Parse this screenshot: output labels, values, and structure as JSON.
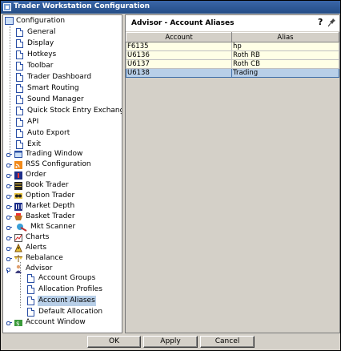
{
  "window": {
    "title": "Trader Workstation Configuration"
  },
  "tree": {
    "root": "Configuration",
    "items": [
      {
        "label": "General",
        "icon": "page-icon"
      },
      {
        "label": "Display",
        "icon": "page-icon"
      },
      {
        "label": "Hotkeys",
        "icon": "page-icon"
      },
      {
        "label": "Toolbar",
        "icon": "page-icon"
      },
      {
        "label": "Trader Dashboard",
        "icon": "page-icon"
      },
      {
        "label": "Smart Routing",
        "icon": "page-icon"
      },
      {
        "label": "Sound Manager",
        "icon": "page-icon"
      },
      {
        "label": "Quick Stock Entry Exchanges",
        "icon": "page-icon"
      },
      {
        "label": "API",
        "icon": "page-icon"
      },
      {
        "label": "Auto Export",
        "icon": "page-icon"
      },
      {
        "label": "Exit",
        "icon": "page-icon"
      },
      {
        "label": "Trading Window",
        "icon": "trading-window-icon"
      },
      {
        "label": "RSS Configuration",
        "icon": "rss-icon"
      },
      {
        "label": "Order",
        "icon": "order-icon"
      },
      {
        "label": "Book Trader",
        "icon": "book-trader-icon"
      },
      {
        "label": "Option Trader",
        "icon": "option-trader-icon"
      },
      {
        "label": "Market Depth",
        "icon": "market-depth-icon"
      },
      {
        "label": "Basket Trader",
        "icon": "basket-trader-icon"
      },
      {
        "label": "Mkt Scanner",
        "icon": "scanner-icon"
      },
      {
        "label": "Charts",
        "icon": "chart-icon"
      },
      {
        "label": "Alerts",
        "icon": "alert-icon"
      },
      {
        "label": "Rebalance",
        "icon": "rebalance-icon"
      },
      {
        "label": "Advisor",
        "icon": "advisor-icon"
      },
      {
        "label": "Account Groups",
        "icon": "page-icon"
      },
      {
        "label": "Allocation Profiles",
        "icon": "page-icon"
      },
      {
        "label": "Account Aliases",
        "icon": "page-icon"
      },
      {
        "label": "Default Allocation",
        "icon": "page-icon"
      },
      {
        "label": "Account Window",
        "icon": "account-window-icon"
      }
    ]
  },
  "panel": {
    "title": "Advisor - Account Aliases",
    "help": "?",
    "columns": [
      "Account",
      "Alias"
    ],
    "rows": [
      [
        "F6135",
        "hp"
      ],
      [
        "U6136",
        "Roth RB"
      ],
      [
        "U6137",
        "Roth CB"
      ],
      [
        "U6138",
        "Trading"
      ]
    ]
  },
  "buttons": {
    "ok": "OK",
    "apply": "Apply",
    "cancel": "Cancel"
  },
  "colors": {
    "titlebar": "#2f5a98",
    "selection": "#b8cfe8",
    "row_background": "#ffffe6"
  }
}
